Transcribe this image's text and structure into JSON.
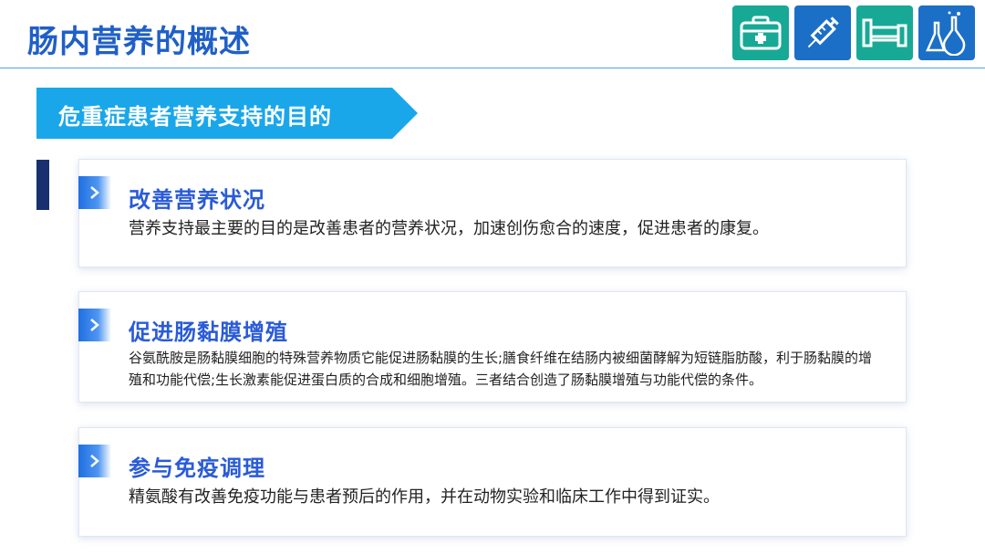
{
  "page": {
    "title": "肠内营养的概述"
  },
  "icons": [
    "medical-kit-icon",
    "syringe-icon",
    "hospital-bed-icon",
    "lab-flask-icon"
  ],
  "banner": {
    "text": "危重症患者营养支持的目的"
  },
  "sections": [
    {
      "heading": "改善营养状况",
      "body": "营养支持最主要的目的是改善患者的营养状况，加速创伤愈合的速度，促进患者的康复。"
    },
    {
      "heading": "促进肠黏膜增殖",
      "body": "谷氨酰胺是肠黏膜细胞的特殊营养物质它能促进肠黏膜的生长;膳食纤维在结肠内被细菌酵解为短链脂肪酸，利于肠黏膜的增殖和功能代偿;生长激素能促进蛋白质的合成和细胞增殖。三者结合创造了肠黏膜增殖与功能代偿的条件。"
    },
    {
      "heading": "参与免疫调理",
      "body": "精氨酸有改善免疫功能与患者预后的作用，并在动物实验和临床工作中得到证实。"
    }
  ],
  "colors": {
    "title": "#1f5fc7",
    "banner": "#1aa7ea",
    "heading": "#2a5bd7",
    "tile_teal": "#17a996",
    "tile_blue": "#1c6fc6",
    "side_bar": "#1a2f6d"
  }
}
